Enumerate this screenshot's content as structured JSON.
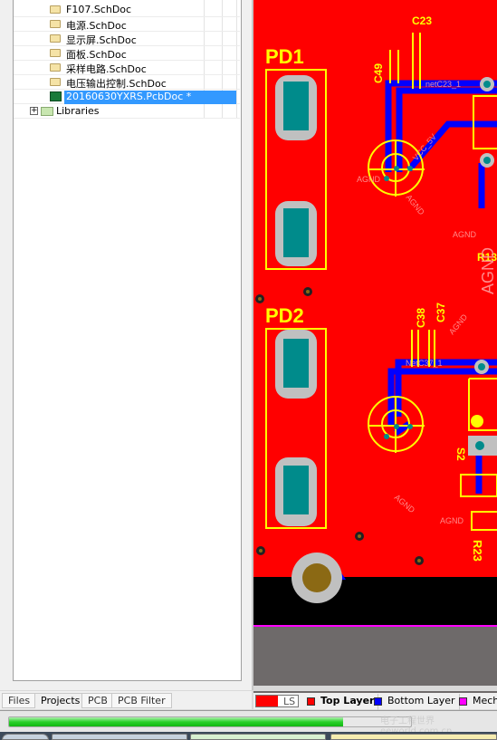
{
  "projects_tree": {
    "items": [
      {
        "label": "F107.SchDoc",
        "icon": "schematic-doc-icon"
      },
      {
        "label": "电源.SchDoc",
        "icon": "schematic-doc-icon"
      },
      {
        "label": "显示屏.SchDoc",
        "icon": "schematic-doc-icon"
      },
      {
        "label": "面板.SchDoc",
        "icon": "schematic-doc-icon"
      },
      {
        "label": "采样电路.SchDoc",
        "icon": "schematic-doc-icon"
      },
      {
        "label": "电压输出控制.SchDoc",
        "icon": "schematic-doc-icon"
      },
      {
        "label": "20160630YXRS.PcbDoc *",
        "icon": "pcb-doc-icon",
        "selected": true
      }
    ],
    "libraries": {
      "label": "Libraries",
      "expander": "+"
    }
  },
  "panel_tabs": [
    {
      "label": "Files"
    },
    {
      "label": "Projects",
      "active": true
    },
    {
      "label": "PCB"
    },
    {
      "label": "PCB Filter"
    }
  ],
  "layer_tabs": {
    "current_layer_color": "#ff0000",
    "ls_label": "LS",
    "layers": [
      {
        "label": "Top Layer",
        "color": "#ff0000",
        "active": true
      },
      {
        "label": "Bottom Layer",
        "color": "#0000ff"
      },
      {
        "label": "Mech",
        "color": "#ff00ff"
      }
    ]
  },
  "pcb": {
    "colors": {
      "top": "#ff0000",
      "bottom": "#0000ff",
      "overlay": "#ffff00",
      "pad": "#008b8b"
    },
    "labels": {
      "pd1": "PD1",
      "pd2": "PD2",
      "c23": "C23",
      "c49": "C49",
      "c38": "C38",
      "c37": "C37",
      "s2": "S2",
      "r23": "R23",
      "r13": "R13",
      "net_c23": "netC23_1",
      "net_vcc": "VCC_5V",
      "net_c37": "NetC37_1",
      "agnd": "AGND"
    }
  },
  "status": {
    "progress_percent": 83
  },
  "watermark": "电子工程世界 eeworld.com.cn"
}
